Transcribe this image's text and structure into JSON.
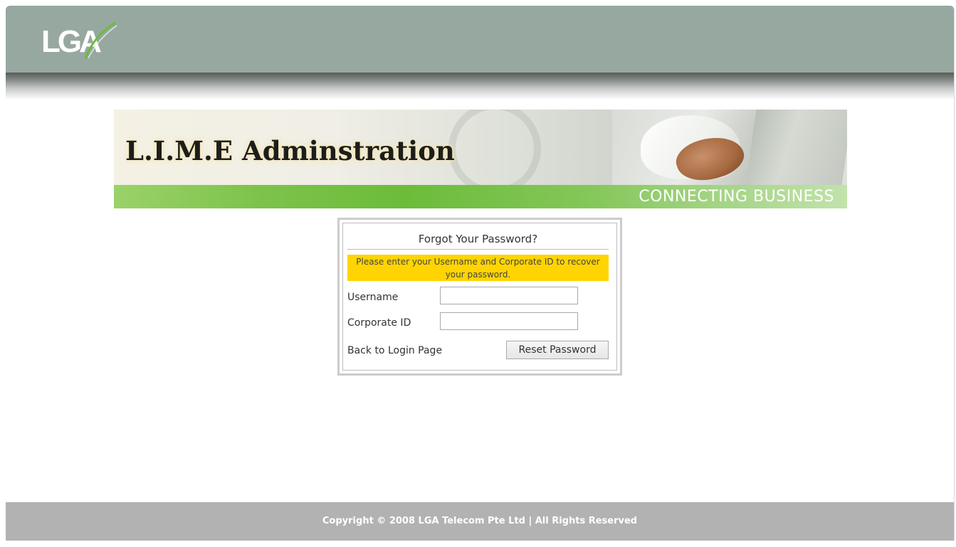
{
  "header": {
    "logo_text": "LGA",
    "background_color": "#97a8a0"
  },
  "banner": {
    "title": "L.I.M.E Adminstration",
    "tagline": "CONNECTING BUSINESS",
    "accent_color": "#7dc34a"
  },
  "forgot_password_form": {
    "title": "Forgot Your Password?",
    "notice": "Please enter your Username and Corporate ID to recover your password.",
    "notice_color": "#ffd400",
    "username_label": "Username",
    "username_value": "",
    "corporate_id_label": "Corporate ID",
    "corporate_id_value": "",
    "back_link": "Back to Login Page",
    "reset_button": "Reset Password"
  },
  "footer": {
    "copyright": "Copyright © 2008 LGA Telecom Pte Ltd | All Rights Reserved"
  }
}
